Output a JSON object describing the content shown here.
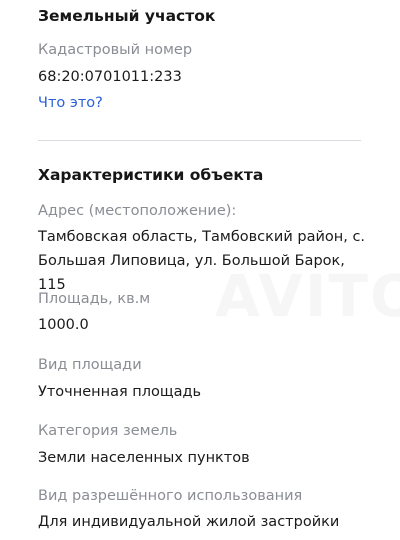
{
  "land": {
    "title": "Земельный участок",
    "cadastral_label": "Кадастровый номер",
    "cadastral_value": "68:20:0701011:233",
    "what_is_it_link": "Что это?"
  },
  "characteristics": {
    "title": "Характеристики объекта",
    "address_label": "Адрес (местоположение):",
    "address_value": "Тамбовская область, Тамбовский район, с. Большая Липовица, ул. Большой Барок, 115",
    "area_label": "Площадь, кв.м",
    "area_value": "1000.0",
    "area_type_label": "Вид площади",
    "area_type_value": "Уточненная площадь",
    "land_category_label": "Категория земель",
    "land_category_value": "Земли населенных пунктов",
    "permitted_use_label": "Вид разрешённого использования",
    "permitted_use_value": "Для индивидуальной жилой застройки"
  },
  "watermark": "AVITO"
}
